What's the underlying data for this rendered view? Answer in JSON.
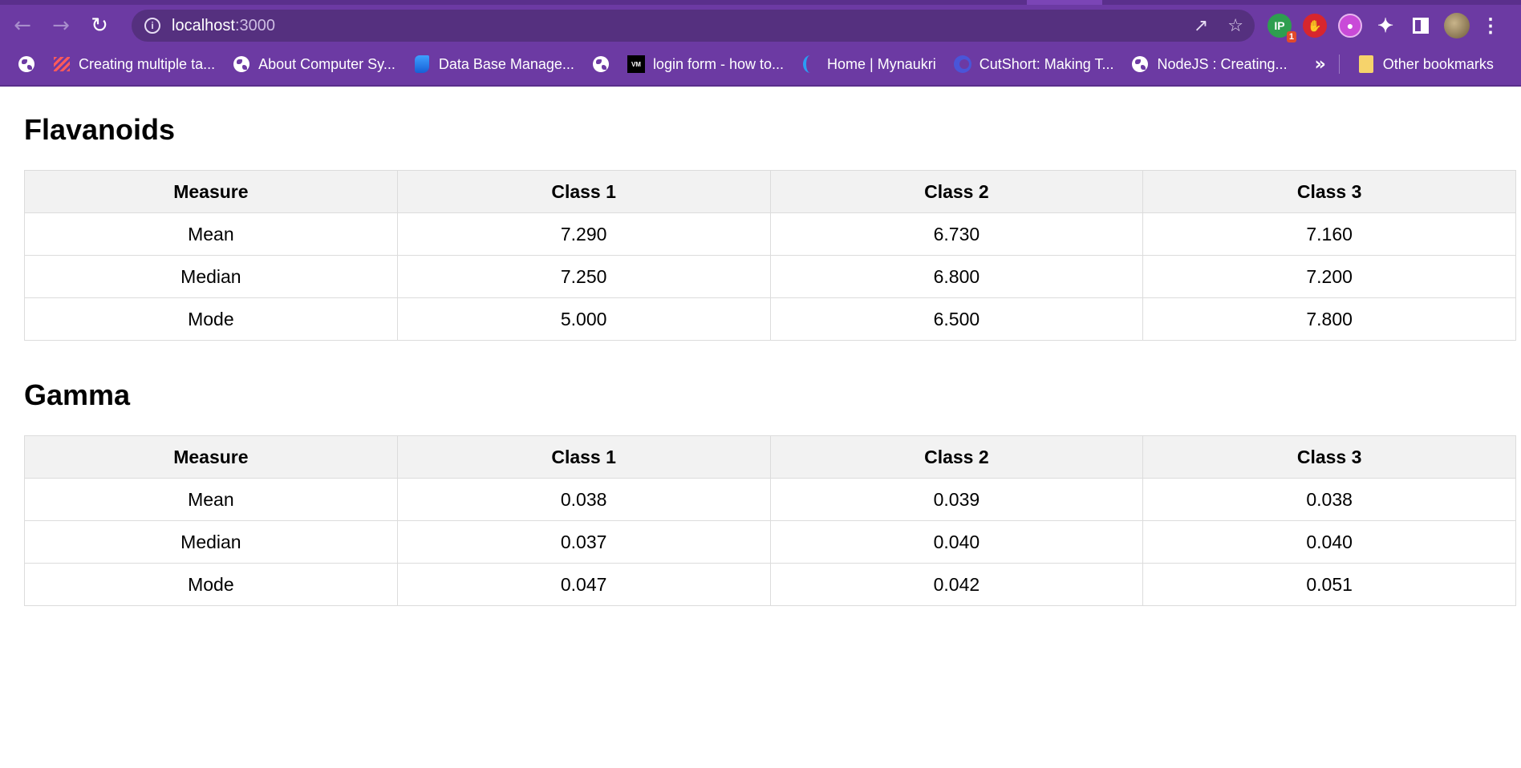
{
  "browser": {
    "url_host": "localhost",
    "url_port": ":3000",
    "extension_badge": "1",
    "bookmarks": [
      {
        "label": "",
        "icon": "globe-icon"
      },
      {
        "label": "Creating multiple ta...",
        "icon": "stripes-icon"
      },
      {
        "label": "About Computer Sy...",
        "icon": "globe-icon"
      },
      {
        "label": "Data Base Manage...",
        "icon": "database-icon"
      },
      {
        "label": "",
        "icon": "globe-icon"
      },
      {
        "label": "login form - how to...",
        "icon": "vm-icon"
      },
      {
        "label": "Home | Mynaukri",
        "icon": "mynaukri-icon"
      },
      {
        "label": "CutShort: Making T...",
        "icon": "cutshort-icon"
      },
      {
        "label": "NodeJS : Creating...",
        "icon": "globe-icon"
      }
    ],
    "more_bookmarks": "»",
    "other_bookmarks": "Other bookmarks",
    "colors": {
      "frame": "#6c3aa3",
      "omnibox": "#55307f"
    }
  },
  "sections": [
    {
      "title": "Flavanoids",
      "headers": [
        "Measure",
        "Class 1",
        "Class 2",
        "Class 3"
      ],
      "rows": [
        [
          "Mean",
          "7.290",
          "6.730",
          "7.160"
        ],
        [
          "Median",
          "7.250",
          "6.800",
          "7.200"
        ],
        [
          "Mode",
          "5.000",
          "6.500",
          "7.800"
        ]
      ]
    },
    {
      "title": "Gamma",
      "headers": [
        "Measure",
        "Class 1",
        "Class 2",
        "Class 3"
      ],
      "rows": [
        [
          "Mean",
          "0.038",
          "0.039",
          "0.038"
        ],
        [
          "Median",
          "0.037",
          "0.040",
          "0.040"
        ],
        [
          "Mode",
          "0.047",
          "0.042",
          "0.051"
        ]
      ]
    }
  ]
}
